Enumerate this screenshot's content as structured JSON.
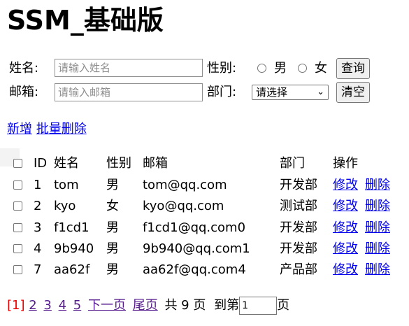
{
  "page_title": "SSM_基础版",
  "search": {
    "name_label": "姓名:",
    "name_placeholder": "请输入姓名",
    "gender_label": "性别:",
    "gender_options": [
      "男",
      "女"
    ],
    "query_button": "查询",
    "email_label": "邮箱:",
    "email_placeholder": "请输入邮箱",
    "dept_label": "部门:",
    "dept_selected": "请选择",
    "clear_button": "清空"
  },
  "actions": {
    "add": "新增",
    "batch_delete": "批量删除"
  },
  "table": {
    "headers": {
      "id": "ID",
      "name": "姓名",
      "gender": "性别",
      "email": "邮箱",
      "dept": "部门",
      "ops": "操作"
    },
    "rows": [
      {
        "id": "1",
        "name": "tom",
        "gender": "男",
        "email": "tom@qq.com",
        "dept": "开发部",
        "edit": "修改",
        "del": "删除"
      },
      {
        "id": "2",
        "name": "kyo",
        "gender": "女",
        "email": "kyo@qq.com",
        "dept": "测试部",
        "edit": "修改",
        "del": "删除"
      },
      {
        "id": "3",
        "name": "f1cd1",
        "gender": "男",
        "email": "f1cd1@qq.com0",
        "dept": "开发部",
        "edit": "修改",
        "del": "删除"
      },
      {
        "id": "4",
        "name": "9b940",
        "gender": "男",
        "email": "9b940@qq.com1",
        "dept": "开发部",
        "edit": "修改",
        "del": "删除"
      },
      {
        "id": "7",
        "name": "aa62f",
        "gender": "男",
        "email": "aa62f@qq.com4",
        "dept": "产品部",
        "edit": "修改",
        "del": "删除"
      }
    ]
  },
  "pager": {
    "current": "[1]",
    "pages": [
      "2",
      "3",
      "4",
      "5"
    ],
    "next": "下一页",
    "last": "尾页",
    "total_text": "共 9 页",
    "goto_prefix": "到第",
    "goto_value": "1",
    "goto_suffix": "页"
  }
}
